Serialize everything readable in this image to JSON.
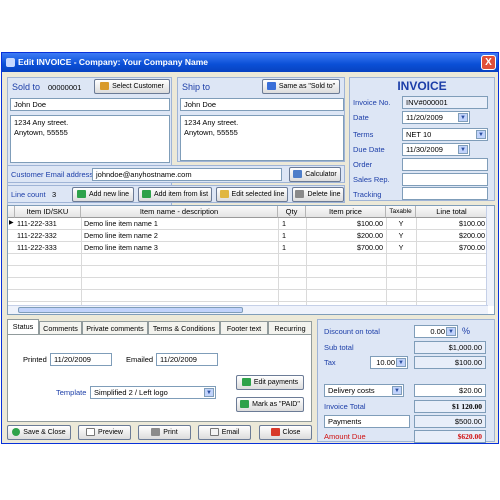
{
  "window": {
    "title": "Edit INVOICE - Company: Your Company Name",
    "close": "X"
  },
  "sold_to": {
    "label": "Sold to",
    "number": "00000001",
    "button": "Select Customer",
    "name": "John Doe",
    "address1": "1234 Any street.",
    "address2": "Anytown, 55555"
  },
  "ship_to": {
    "label": "Ship to",
    "button": "Same as \"Sold to\"",
    "name": "John Doe",
    "address1": "1234 Any street.",
    "address2": "Anytown, 55555"
  },
  "invoice": {
    "heading": "INVOICE",
    "fields": [
      {
        "label": "Invoice No.",
        "value": "INV#000001"
      },
      {
        "label": "Date",
        "value": "11/20/2009"
      },
      {
        "label": "Terms",
        "value": "NET 10"
      },
      {
        "label": "Due Date",
        "value": "11/30/2009"
      },
      {
        "label": "Order",
        "value": ""
      },
      {
        "label": "Sales Rep.",
        "value": ""
      },
      {
        "label": "Tracking",
        "value": ""
      }
    ]
  },
  "email": {
    "label": "Customer Email address",
    "value": "johndoe@anyhostname.com",
    "calculator": "Calculator"
  },
  "line_toolbar": {
    "count_label": "Line count",
    "count": "3",
    "add_new": "Add new line",
    "add_from_list": "Add item from list",
    "edit": "Edit selected line",
    "delete": "Delete line"
  },
  "table": {
    "headers": [
      "Item ID/SKU",
      "Item name - description",
      "Qty",
      "Item price",
      "Taxable",
      "Line total"
    ],
    "rows": [
      {
        "sku": "111-222-331",
        "name": "Demo line item name 1",
        "qty": "1",
        "price": "$100.00",
        "taxable": "Y",
        "total": "$100.00"
      },
      {
        "sku": "111-222-332",
        "name": "Demo line item name 2",
        "qty": "1",
        "price": "$200.00",
        "taxable": "Y",
        "total": "$200.00"
      },
      {
        "sku": "111-222-333",
        "name": "Demo line item name 3",
        "qty": "1",
        "price": "$700.00",
        "taxable": "Y",
        "total": "$700.00"
      }
    ]
  },
  "tabs": [
    "Status",
    "Comments",
    "Private comments",
    "Terms & Conditions",
    "Footer text",
    "Recurring"
  ],
  "status_tab": {
    "printed_label": "Printed",
    "printed": "11/20/2009",
    "emailed_label": "Emailed",
    "emailed": "11/20/2009",
    "template_label": "Template",
    "template": "Simplified 2 / Left logo",
    "edit_payments": "Edit payments",
    "mark_paid": "Mark as \"PAID\""
  },
  "totals": {
    "discount_label": "Discount on total",
    "discount": "0.00",
    "discount_unit": "%",
    "subtotal_label": "Sub total",
    "subtotal": "$1,000.00",
    "tax_label": "Tax",
    "tax_rate": "10.00",
    "tax": "$100.00",
    "delivery_label": "Delivery costs",
    "delivery": "$20.00",
    "invoice_total_label": "Invoice Total",
    "invoice_total": "$1 120.00",
    "payments_label": "Payments",
    "payments": "$500.00",
    "amount_due_label": "Amount Due",
    "amount_due": "$620.00"
  },
  "bottom_buttons": {
    "save": "Save & Close",
    "preview": "Preview",
    "print": "Print",
    "email": "Email",
    "close": "Close"
  },
  "colors": {
    "title_blue": "#0a4fd6",
    "panel": "#dde6f5",
    "label_blue": "#1c3ea8",
    "amount_due": "#d01010"
  }
}
